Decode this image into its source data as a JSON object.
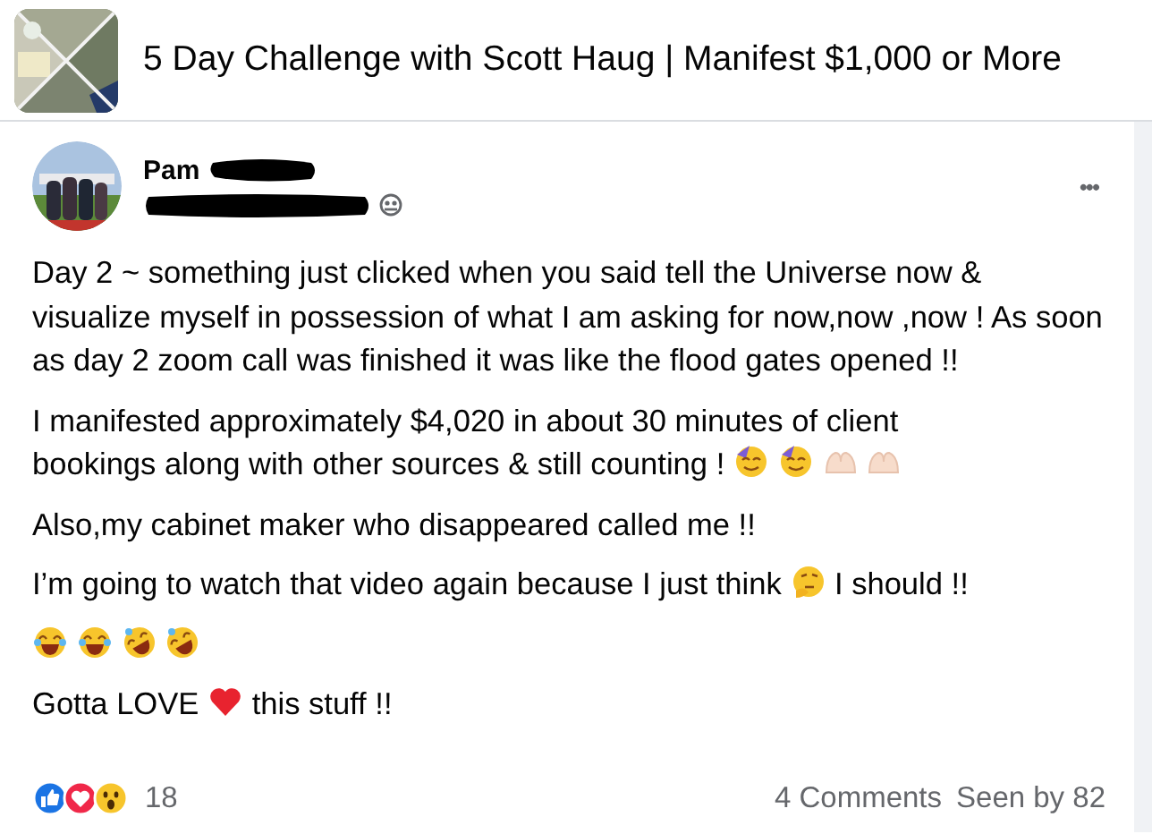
{
  "group": {
    "title": "5 Day Challenge with Scott Haug | Manifest $1,000 or More"
  },
  "post": {
    "author": "Pam",
    "menu": "•••",
    "paragraphs": [
      {
        "parts": [
          {
            "kind": "text",
            "text": "Day 2 ~ something just clicked when you said tell the Universe now & visualize myself in possession of what I am asking for now,now ,now ! As soon as day 2 zoom call was finished it was like the flood gates opened !!"
          }
        ]
      },
      {
        "parts": [
          {
            "kind": "line",
            "text": "I manifested approximately $4,020 in about 30 minutes of client"
          },
          {
            "kind": "text",
            "text": "bookings along with other sources & still counting !"
          },
          {
            "kind": "party"
          },
          {
            "kind": "party"
          },
          {
            "kind": "hands"
          },
          {
            "kind": "hands"
          }
        ]
      },
      {
        "parts": [
          {
            "kind": "text",
            "text": "Also,my cabinet maker who disappeared called me !!"
          }
        ]
      },
      {
        "parts": [
          {
            "kind": "text",
            "text": "I’m going to watch that video again because I just think"
          },
          {
            "kind": "thinking"
          },
          {
            "kind": "text",
            "text": "I should !!"
          }
        ]
      },
      {
        "parts": [
          {
            "kind": "laugh"
          },
          {
            "kind": "laugh"
          },
          {
            "kind": "rofl"
          },
          {
            "kind": "rofl"
          }
        ]
      },
      {
        "parts": [
          {
            "kind": "text",
            "text": "Gotta LOVE"
          },
          {
            "kind": "heart"
          },
          {
            "kind": "text",
            "text": "this stuff !!"
          }
        ]
      }
    ],
    "reactions": {
      "kinds": [
        {
          "kind": "like"
        },
        {
          "kind": "love"
        },
        {
          "kind": "wow"
        }
      ],
      "count": "18"
    },
    "comments": "4 Comments",
    "seen_by": "Seen by 82"
  }
}
